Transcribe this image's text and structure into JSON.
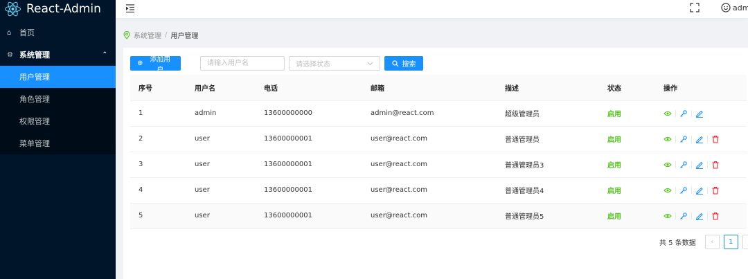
{
  "app": {
    "title": "React-Admin"
  },
  "sidebar": {
    "home": "首页",
    "system": "系统管理",
    "items": [
      "用户管理",
      "角色管理",
      "权限管理",
      "菜单管理"
    ]
  },
  "header": {
    "username": "admin"
  },
  "breadcrumb": {
    "root": "系统管理",
    "separator": "/",
    "current": "用户管理"
  },
  "toolbar": {
    "add_label": "添加用户",
    "username_placeholder": "请输入用户名",
    "status_placeholder": "请选择状态",
    "search_label": "搜索"
  },
  "table": {
    "headers": [
      "序号",
      "用户名",
      "电话",
      "邮箱",
      "描述",
      "状态",
      "操作"
    ],
    "rows": [
      {
        "index": "1",
        "username": "admin",
        "phone": "13600000000",
        "email": "admin@react.com",
        "desc": "超级管理员",
        "status": "启用"
      },
      {
        "index": "2",
        "username": "user",
        "phone": "13600000001",
        "email": "user@react.com",
        "desc": "普通管理员",
        "status": "启用"
      },
      {
        "index": "3",
        "username": "user",
        "phone": "13600000001",
        "email": "user@react.com",
        "desc": "普通管理员3",
        "status": "启用"
      },
      {
        "index": "4",
        "username": "user",
        "phone": "13600000001",
        "email": "user@react.com",
        "desc": "普通管理员4",
        "status": "启用"
      },
      {
        "index": "5",
        "username": "user",
        "phone": "13600000001",
        "email": "user@react.com",
        "desc": "普通管理员5",
        "status": "启用"
      }
    ]
  },
  "pagination": {
    "total_label": "共 5 条数据",
    "current_page": "1",
    "prev": "‹",
    "next": "›"
  },
  "colors": {
    "primary": "#1890ff",
    "sider": "#001529",
    "success": "#52c41a",
    "danger": "#f5222d"
  },
  "icons": [
    "react-logo-icon",
    "home-icon",
    "setting-icon",
    "chevron-up-icon",
    "menu-fold-icon",
    "fullscreen-icon",
    "smile-icon",
    "environment-icon",
    "plus-circle-icon",
    "search-icon",
    "down-icon",
    "eye-icon",
    "key-icon",
    "edit-icon",
    "delete-icon"
  ]
}
